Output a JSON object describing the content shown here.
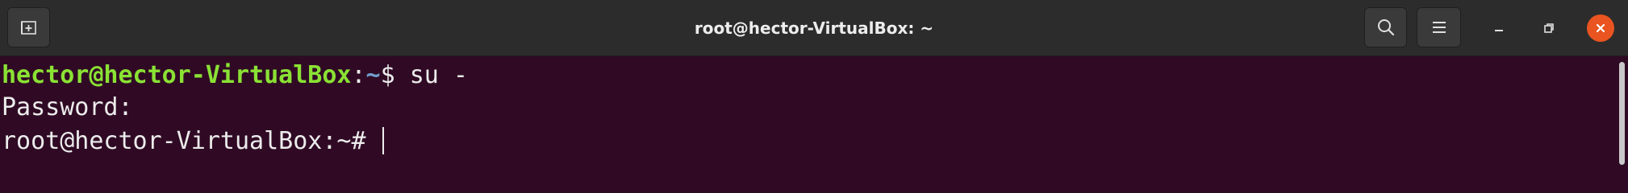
{
  "window": {
    "title": "root@hector-VirtualBox: ~"
  },
  "header": {
    "new_tab_icon": "new-tab-icon",
    "search_icon": "search-icon",
    "menu_icon": "hamburger-menu-icon",
    "minimize_icon": "minimize-icon",
    "maximize_icon": "restore-icon",
    "close_icon": "close-icon",
    "close_color": "#e95420"
  },
  "terminal": {
    "background": "#300a24",
    "prompt_user_color": "#8ae234",
    "prompt_path_color": "#729fcf",
    "lines": [
      {
        "user_host": "hector@hector-VirtualBox",
        "colon": ":",
        "path": "~",
        "prompt_end": "$ ",
        "command": "su -"
      },
      {
        "text": "Password:"
      },
      {
        "text": "root@hector-VirtualBox:~# "
      }
    ]
  }
}
